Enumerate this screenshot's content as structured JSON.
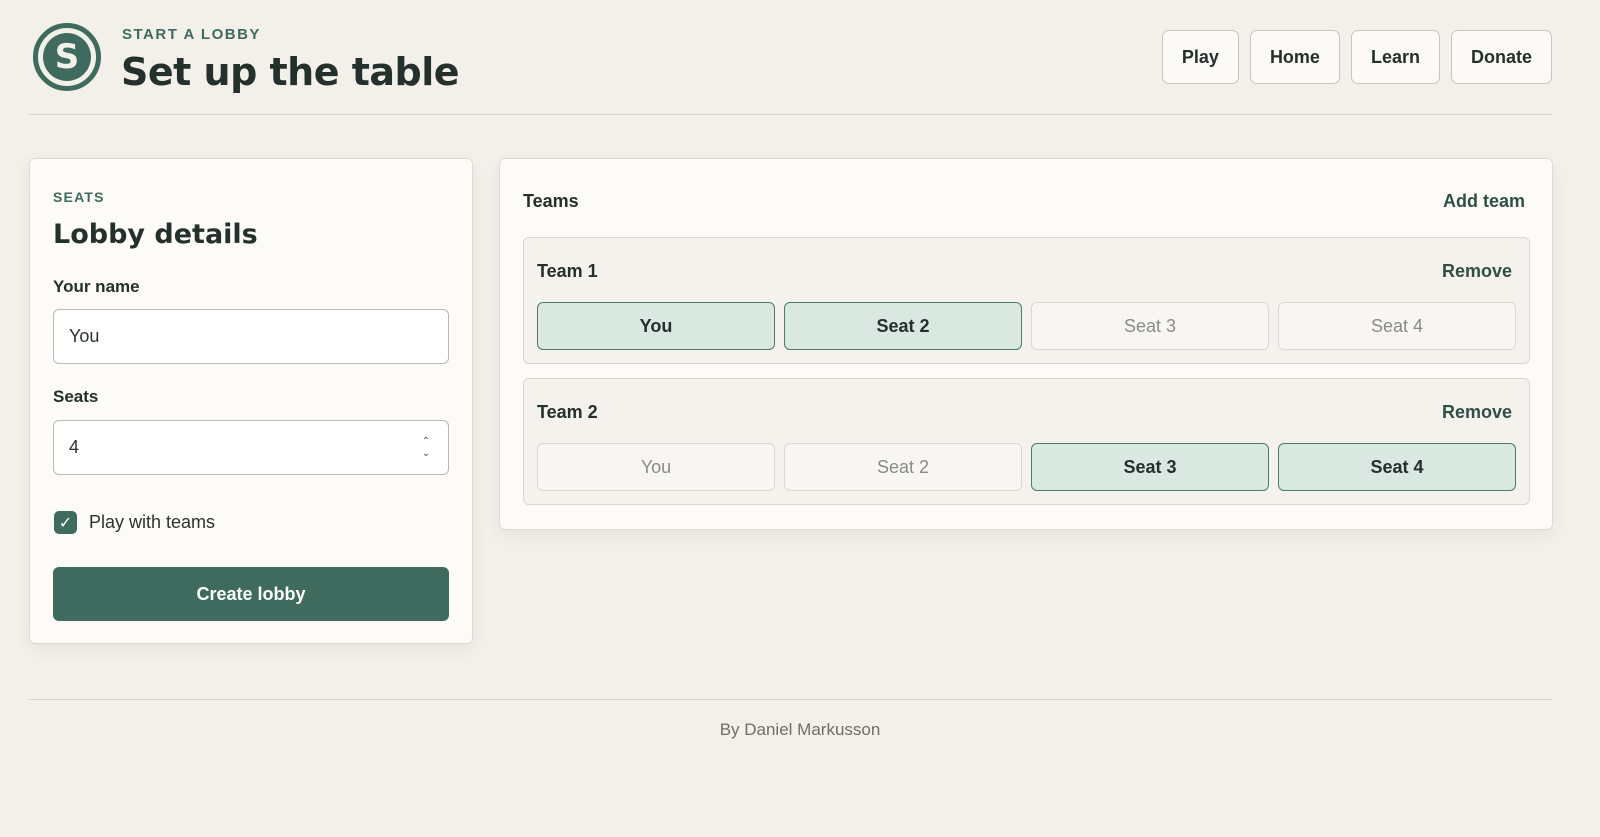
{
  "header": {
    "logo_letter": "S",
    "kicker": "START A LOBBY",
    "title": "Set up the table",
    "nav": [
      "Play",
      "Home",
      "Learn",
      "Donate"
    ]
  },
  "lobby": {
    "eyebrow": "SEATS",
    "title": "Lobby details",
    "name_label": "Your name",
    "name_value": "You",
    "seats_label": "Seats",
    "seats_value": "4",
    "teams_checkbox_label": "Play with teams",
    "teams_checked": true,
    "create_label": "Create lobby"
  },
  "teams": {
    "title": "Teams",
    "add_label": "Add team",
    "remove_label": "Remove",
    "list": [
      {
        "name": "Team 1",
        "seats": [
          {
            "label": "You",
            "selected": true
          },
          {
            "label": "Seat 2",
            "selected": true
          },
          {
            "label": "Seat 3",
            "selected": false
          },
          {
            "label": "Seat 4",
            "selected": false
          }
        ]
      },
      {
        "name": "Team 2",
        "seats": [
          {
            "label": "You",
            "selected": false
          },
          {
            "label": "Seat 2",
            "selected": false
          },
          {
            "label": "Seat 3",
            "selected": true
          },
          {
            "label": "Seat 4",
            "selected": true
          }
        ]
      }
    ]
  },
  "footer": {
    "credit": "By Daniel Markusson"
  },
  "colors": {
    "accent": "#3e6b5e",
    "background": "#f3f0ea",
    "selected_seat": "#d9e8e1"
  }
}
